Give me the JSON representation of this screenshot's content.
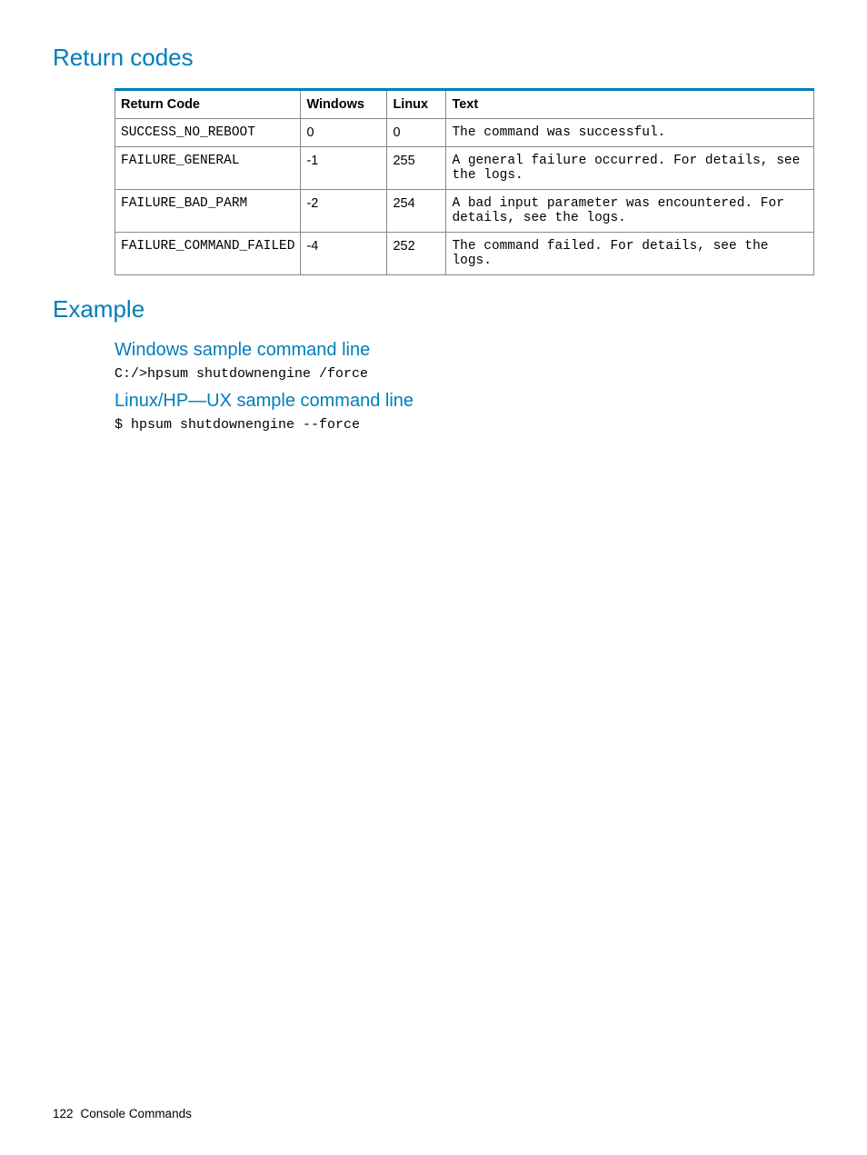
{
  "headings": {
    "return_codes": "Return codes",
    "example": "Example",
    "win_sample": "Windows sample command line",
    "linux_sample": "Linux/HP—UX sample command line"
  },
  "table": {
    "headers": {
      "return_code": "Return Code",
      "windows": "Windows",
      "linux": "Linux",
      "text": "Text"
    },
    "rows": [
      {
        "return_code": "SUCCESS_NO_REBOOT",
        "windows": "0",
        "linux": "0",
        "text": "The command was successful."
      },
      {
        "return_code": "FAILURE_GENERAL",
        "windows": "-1",
        "linux": "255",
        "text": "A general failure occurred. For details, see the logs."
      },
      {
        "return_code": "FAILURE_BAD_PARM",
        "windows": "-2",
        "linux": "254",
        "text": "A bad input parameter was encountered. For details, see the logs."
      },
      {
        "return_code": "FAILURE_COMMAND_FAILED",
        "windows": "-4",
        "linux": "252",
        "text": "The command failed. For details, see the logs."
      }
    ]
  },
  "commands": {
    "windows": "C:/>hpsum shutdownengine /force",
    "linux": "$ hpsum shutdownengine --force"
  },
  "footer": {
    "page_number": "122",
    "section": "Console Commands"
  }
}
